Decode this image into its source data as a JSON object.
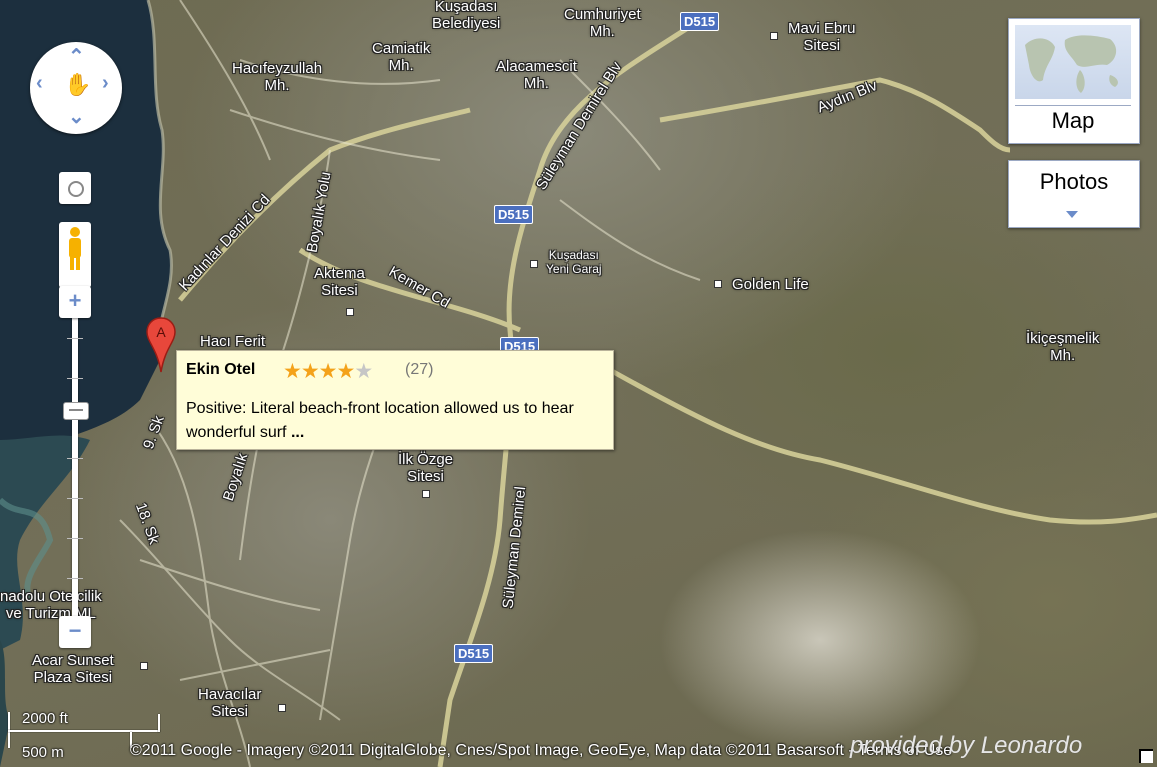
{
  "map": {
    "type": "satellite",
    "places": [
      {
        "name": "Kuşadası\nBelediyesi"
      },
      {
        "name": "Cumhuriyet\nMh."
      },
      {
        "name": "Mavi Ebru\nSitesi"
      },
      {
        "name": "Camiatik\nMh."
      },
      {
        "name": "Alacamescit\nMh."
      },
      {
        "name": "Hacıfeyzullah\nMh."
      },
      {
        "name": "Kuşadası\nYeni Garaj"
      },
      {
        "name": "Golden Life"
      },
      {
        "name": "Aktema\nSitesi"
      },
      {
        "name": "Hacı Ferit"
      },
      {
        "name": "İkiçeşmelik\nMh."
      },
      {
        "name": "İlk Özge\nSitesi"
      },
      {
        "name": "nadolu Otelcilik\nve Turizm ML"
      },
      {
        "name": "Acar Sunset\nPlaza Sitesi"
      },
      {
        "name": "Havacılar\nSitesi"
      }
    ],
    "roads": [
      {
        "name": "Kadınlar Denizi Cd"
      },
      {
        "name": "Boyalık Yolu"
      },
      {
        "name": "Kemer Cd"
      },
      {
        "name": "Süleyman Demirel Blv"
      },
      {
        "name": "Aydın Blv"
      },
      {
        "name": "9. Sk"
      },
      {
        "name": "18. Sk"
      },
      {
        "name": "Boyalık"
      },
      {
        "name": "Süleyman Demirel"
      }
    ],
    "shields": [
      "D515",
      "D515",
      "D515",
      "D515"
    ]
  },
  "controls": {
    "map_type_label": "Map",
    "photos_label": "Photos",
    "zoom_in": "+",
    "zoom_out": "−",
    "zoom_level_fraction": 0.29
  },
  "marker": {
    "label": "A",
    "color": "#e8473b"
  },
  "infowindow": {
    "title": "Ekin Otel",
    "rating": 4,
    "max_rating": 5,
    "review_count": "(27)",
    "review_text": "Positive: Literal beach-front location allowed us to hear wonderful surf",
    "more": "..."
  },
  "scale": {
    "imperial": "2000 ft",
    "metric": "500 m"
  },
  "copyright": "©2011 Google - Imagery ©2011 DigitalGlobe, Cnes/Spot Image, GeoEye, Map data ©2011 Basarsoft - Terms of Use",
  "credit": "provided by Leonardo"
}
